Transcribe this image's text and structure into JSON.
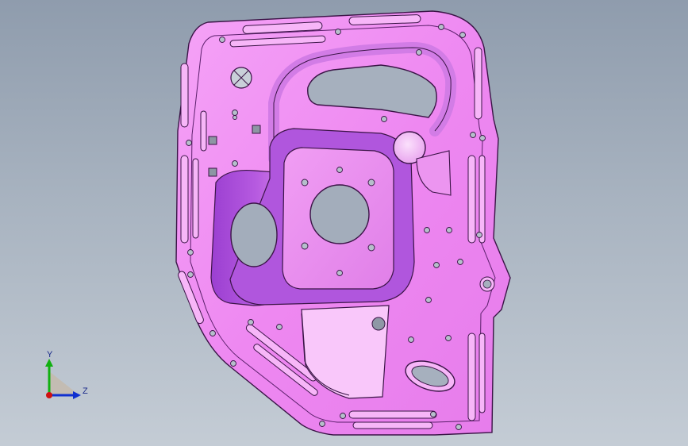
{
  "viewport": {
    "background_top": "#8f9cad",
    "background_bottom": "#c4ccd5",
    "part_color": "#f08cf3",
    "part_shadow": "#b34fd6",
    "part_dark": "#7d2fa8",
    "edge_color": "#3a1446"
  },
  "triad": {
    "y_label": "Y",
    "z_label": "Z",
    "x_color": "#d01010",
    "y_color": "#10b010",
    "z_color": "#1030d0"
  }
}
